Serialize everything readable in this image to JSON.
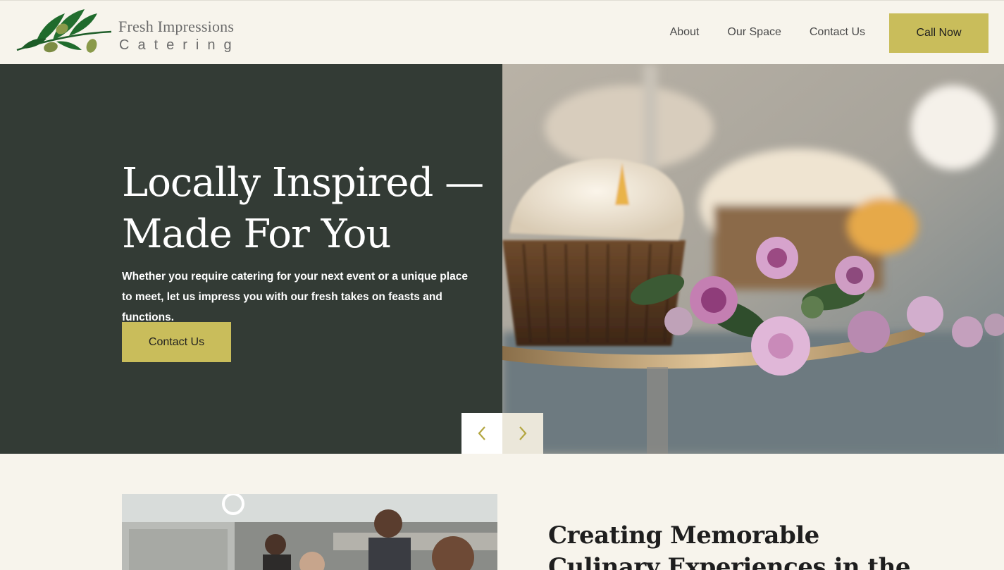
{
  "brand": {
    "name_line1": "Fresh Impressions",
    "name_line2": "Catering"
  },
  "nav": {
    "items": [
      {
        "label": "About"
      },
      {
        "label": "Our Space"
      },
      {
        "label": "Contact Us"
      }
    ],
    "call_label": "Call Now"
  },
  "hero": {
    "title": "Locally Inspired — Made For You",
    "subtitle": "Whether you require catering for your next event or a unique place to meet, let us impress you with our fresh takes on feasts and functions.",
    "cta_label": "Contact Us"
  },
  "about": {
    "title": "Creating Memorable Culinary Experiences in the"
  },
  "colors": {
    "accent": "#c9bd5b",
    "hero_bg": "#333b35",
    "page_bg": "#f7f4ec"
  },
  "icons": {
    "logo": "olive-branch-logo",
    "prev": "chevron-left-icon",
    "next": "chevron-right-icon"
  }
}
